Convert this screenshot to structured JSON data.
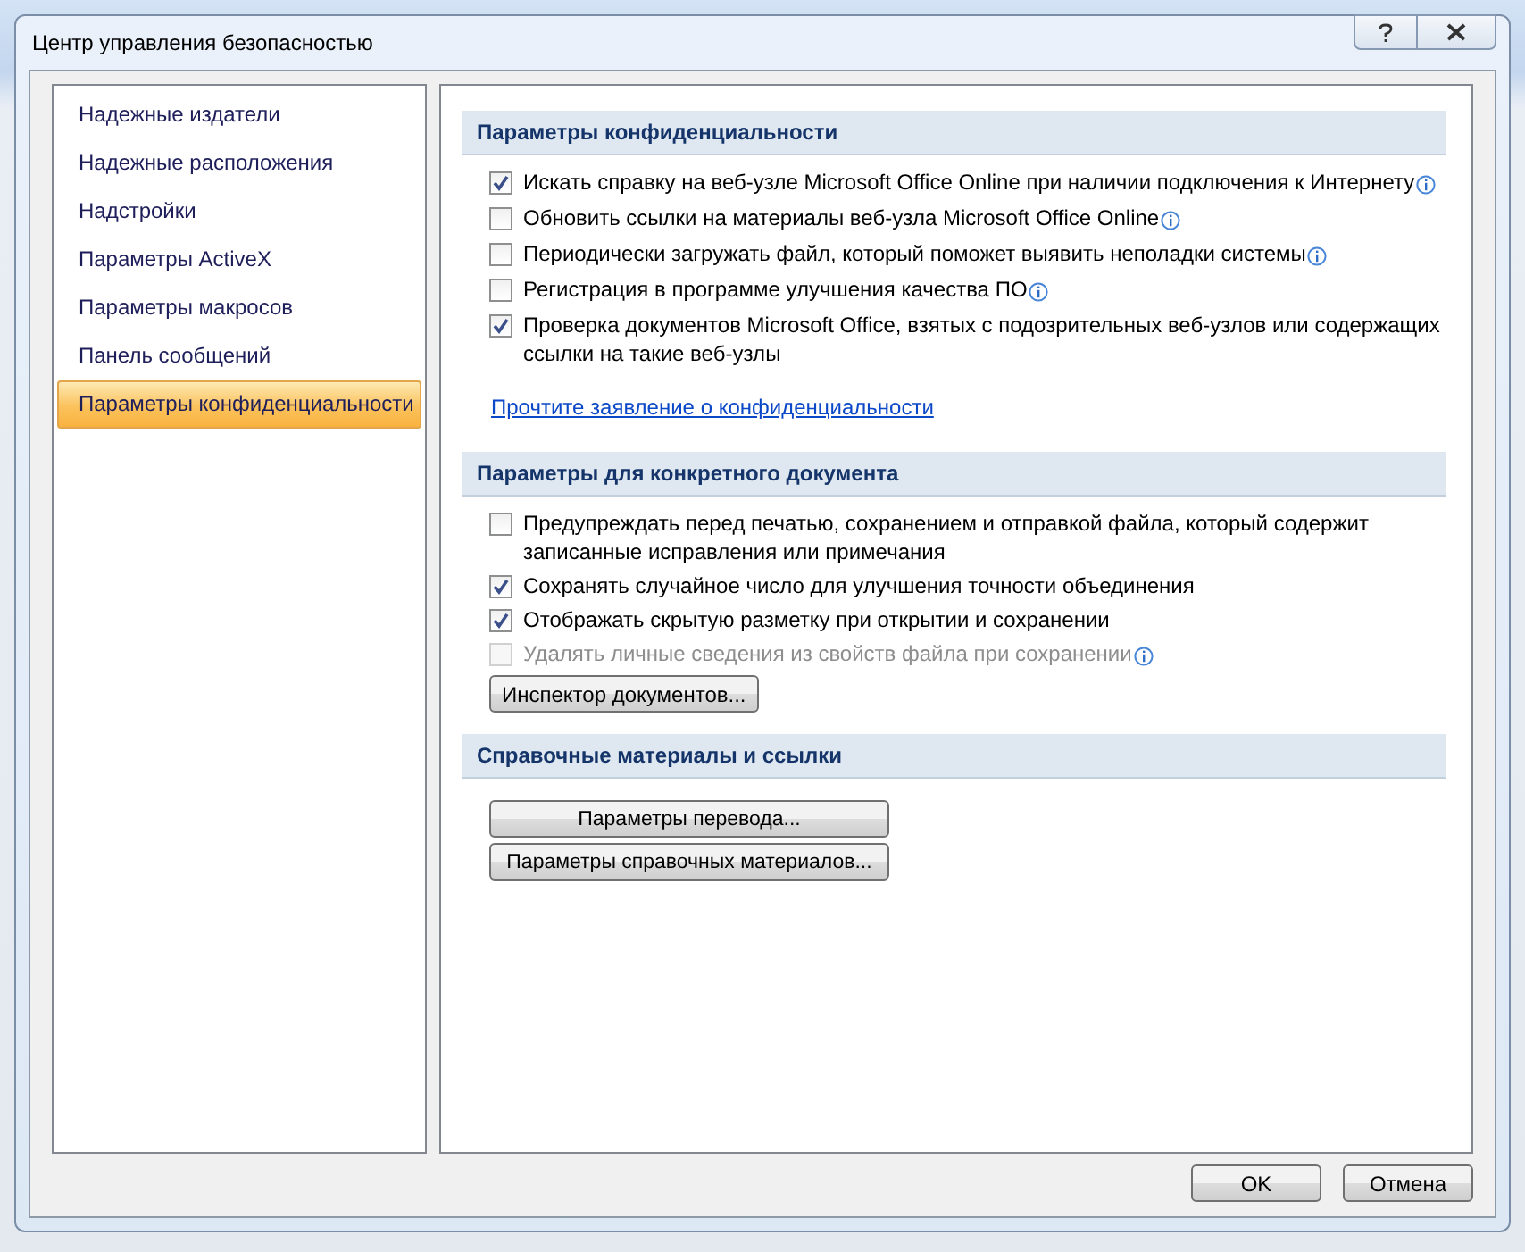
{
  "window": {
    "title": "Центр управления безопасностью"
  },
  "sidebar": {
    "items": [
      {
        "label": "Надежные издатели",
        "selected": false
      },
      {
        "label": "Надежные расположения",
        "selected": false
      },
      {
        "label": "Надстройки",
        "selected": false
      },
      {
        "label": "Параметры ActiveX",
        "selected": false
      },
      {
        "label": "Параметры макросов",
        "selected": false
      },
      {
        "label": "Панель сообщений",
        "selected": false
      },
      {
        "label": "Параметры конфиденциальности",
        "selected": true
      }
    ]
  },
  "sections": [
    {
      "title": "Параметры конфиденциальности",
      "items": [
        {
          "kind": "checkbox",
          "label": "Искать справку на веб-узле Microsoft Office Online при наличии подключения к Интернету",
          "checked": true,
          "disabled": false,
          "info": true
        },
        {
          "kind": "checkbox",
          "label": "Обновить ссылки на материалы веб-узла Microsoft Office Online",
          "checked": false,
          "disabled": false,
          "info": true
        },
        {
          "kind": "checkbox",
          "label": "Периодически загружать файл, который поможет выявить неполадки системы",
          "checked": false,
          "disabled": false,
          "info": true
        },
        {
          "kind": "checkbox",
          "label": "Регистрация в программе улучшения качества ПО",
          "checked": false,
          "disabled": false,
          "info": true
        },
        {
          "kind": "checkbox",
          "label": "Проверка документов Microsoft Office, взятых с подозрительных веб-узлов или содержащих ссылки на такие веб-узлы",
          "checked": true,
          "disabled": false,
          "info": false
        },
        {
          "kind": "link",
          "label": "Прочтите заявление о конфиденциальности"
        }
      ]
    },
    {
      "title": "Параметры для конкретного документа",
      "items": [
        {
          "kind": "checkbox",
          "label": "Предупреждать перед печатью, сохранением и отправкой файла, который содержит записанные исправления или примечания",
          "checked": false,
          "disabled": false,
          "info": false
        },
        {
          "kind": "checkbox",
          "label": "Сохранять случайное число для улучшения точности объединения",
          "checked": true,
          "disabled": false,
          "info": false
        },
        {
          "kind": "checkbox",
          "label": "Отображать скрытую разметку при открытии и сохранении",
          "checked": true,
          "disabled": false,
          "info": false
        },
        {
          "kind": "checkbox",
          "label": "Удалять личные сведения из свойств файла при сохранении",
          "checked": false,
          "disabled": true,
          "info": true
        },
        {
          "kind": "button",
          "label": "Инспектор документов..."
        }
      ]
    },
    {
      "title": "Справочные материалы и ссылки",
      "items": [
        {
          "kind": "button",
          "label": "Параметры перевода...",
          "wide": true
        },
        {
          "kind": "button",
          "label": "Параметры справочных материалов...",
          "wide": true
        }
      ]
    }
  ],
  "buttons": [
    "OK",
    "Отмена"
  ]
}
